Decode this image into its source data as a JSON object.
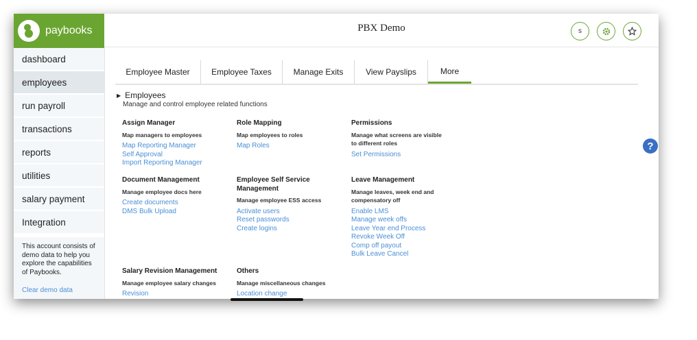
{
  "app": {
    "logo_text": "paybooks",
    "brand_color": "#6aa531"
  },
  "header": {
    "title": "PBX Demo",
    "profile_initial": "s",
    "icons": [
      "gear-icon",
      "star-icon"
    ]
  },
  "sidebar": {
    "items": [
      {
        "label": "dashboard",
        "active": false
      },
      {
        "label": "employees",
        "active": true
      },
      {
        "label": "run payroll",
        "active": false
      },
      {
        "label": "transactions",
        "active": false
      },
      {
        "label": "reports",
        "active": false
      },
      {
        "label": "utilities",
        "active": false
      },
      {
        "label": "salary payment",
        "active": false
      },
      {
        "label": "Integration",
        "active": false
      }
    ],
    "demo_text": "This account consists of demo data to help you explore the capabilities of Paybooks.",
    "demo_link": "Clear demo data"
  },
  "tabs": [
    {
      "label": "Employee Master",
      "active": false
    },
    {
      "label": "Employee Taxes",
      "active": false
    },
    {
      "label": "Manage Exits",
      "active": false
    },
    {
      "label": "View Payslips",
      "active": false
    },
    {
      "label": "More",
      "active": true
    }
  ],
  "section": {
    "title": "Employees",
    "description": "Manage and control employee related functions"
  },
  "groups": [
    {
      "title": "Assign Manager",
      "desc": "Map managers to employees",
      "links": [
        "Map Reporting Manager",
        "Self Approval",
        "Import Reporting Manager"
      ]
    },
    {
      "title": "Role Mapping",
      "desc": "Map employees to roles",
      "links": [
        "Map Roles"
      ]
    },
    {
      "title": "Permissions",
      "desc": "Manage what screens are visible to different roles",
      "links": [
        "Set Permissions"
      ]
    },
    {
      "title": "Document Management",
      "desc": "Manage employee docs here",
      "links": [
        "Create documents",
        "DMS Bulk Upload"
      ]
    },
    {
      "title": "Employee Self Service Management",
      "desc": "Manage employee ESS access",
      "links": [
        "Activate users",
        "Reset passwords",
        "Create logins"
      ]
    },
    {
      "title": "Leave Management",
      "desc": "Manage leaves, week end and compensatory off",
      "links": [
        "Enable LMS",
        "Manage week offs",
        "Leave Year end Process",
        "Revoke Week Off",
        "Comp off payout",
        "Bulk Leave Cancel"
      ]
    },
    {
      "title": "Salary Revision Management",
      "desc": "Manage employee salary changes",
      "links": [
        "Revision"
      ]
    },
    {
      "title": "Others",
      "desc": "Manage miscellaneous changes",
      "links": [
        "Location change"
      ]
    }
  ],
  "help_icon": "help-icon"
}
